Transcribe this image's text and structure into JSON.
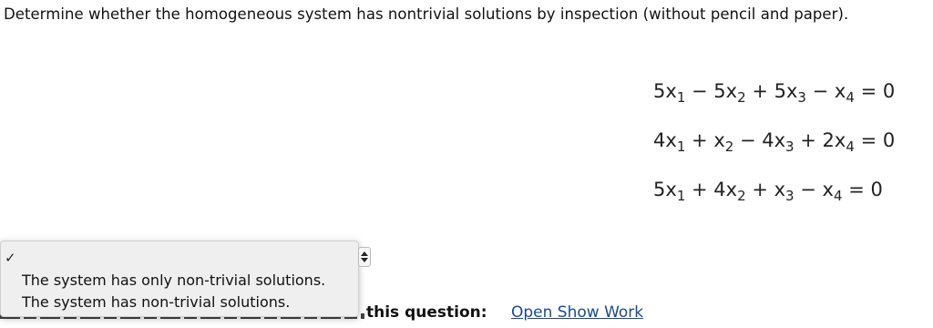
{
  "question": {
    "text": "Determine whether the homogeneous system has nontrivial solutions by inspection (without pencil and paper)."
  },
  "system": {
    "equations": [
      [
        {
          "t": "5"
        },
        {
          "t": "x"
        },
        {
          "sub": "1"
        },
        {
          "t": " − 5"
        },
        {
          "t": "x"
        },
        {
          "sub": "2"
        },
        {
          "t": " + 5"
        },
        {
          "t": "x"
        },
        {
          "sub": "3"
        },
        {
          "t": " − "
        },
        {
          "t": "x"
        },
        {
          "sub": "4"
        },
        {
          "t": " = 0"
        }
      ],
      [
        {
          "t": "4"
        },
        {
          "t": "x"
        },
        {
          "sub": "1"
        },
        {
          "t": " + "
        },
        {
          "t": "x"
        },
        {
          "sub": "2"
        },
        {
          "t": " − 4"
        },
        {
          "t": "x"
        },
        {
          "sub": "3"
        },
        {
          "t": " + 2"
        },
        {
          "t": "x"
        },
        {
          "sub": "4"
        },
        {
          "t": " = 0"
        }
      ],
      [
        {
          "t": "5"
        },
        {
          "t": "x"
        },
        {
          "sub": "1"
        },
        {
          "t": " + 4"
        },
        {
          "t": "x"
        },
        {
          "sub": "2"
        },
        {
          "t": " + "
        },
        {
          "t": "x"
        },
        {
          "sub": "3"
        },
        {
          "t": " − "
        },
        {
          "t": "x"
        },
        {
          "sub": "4"
        },
        {
          "t": " = 0"
        }
      ]
    ]
  },
  "dropdown": {
    "selected_mark": "✓",
    "options": [
      "The system has only non-trivial solutions.",
      "The system has non-trivial solutions."
    ]
  },
  "footer": {
    "label": "this question:",
    "show_work_link": "Open Show Work"
  }
}
